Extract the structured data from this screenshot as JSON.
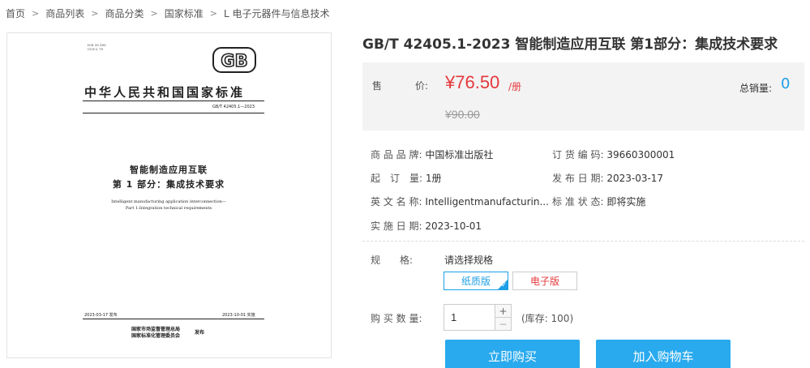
{
  "breadcrumb": {
    "items": [
      "首页",
      "商品列表",
      "商品分类",
      "国家标准",
      "L 电子元器件与信息技术"
    ]
  },
  "cover": {
    "ics_line1": "ICS 35.100",
    "ics_line2": "CCS L 75",
    "logo_text": "GB",
    "std_title": "中华人民共和国国家标准",
    "std_number": "GB/T 42405.1—2023",
    "cn_title_line1": "智能制造应用互联",
    "cn_title_line2": "第 1 部分：集成技术要求",
    "en_title_line1": "Intelligent manufacturing application interconnection—",
    "en_title_line2": "Part 1:Integration technical requirements",
    "issue_date": "2023-03-17 发布",
    "impl_date": "2023-10-01 实施",
    "issuer_line1": "国家市场监督管理总局",
    "issuer_line2": "国家标准化管理委员会",
    "publish_word": "发布"
  },
  "product": {
    "title": "GB/T 42405.1-2023 智能制造应用互联 第1部分：集成技术要求",
    "price_label": "售",
    "price_label2": "价:",
    "price": "¥76.50",
    "price_unit": "/册",
    "original_price": "¥90.00",
    "sales_label": "总销量:",
    "sales_count": "0"
  },
  "info": {
    "brand_label": "商 品 品 牌:",
    "brand_value": "中国标准出版社",
    "order_label": "订 货 编 码:",
    "order_value": "39660300001",
    "min_order_label": "起　订　量:",
    "min_order_value": "1册",
    "release_label": "发 布 日 期:",
    "release_value": "2023-03-17",
    "en_name_label": "英 文 名 称:",
    "en_name_value": "Intelligentmanufacturin...",
    "status_label": "标 准 状 态:",
    "status_value": "即将实施",
    "impl_label": "实 施 日 期:",
    "impl_value": "2023-10-01"
  },
  "spec": {
    "label": "规　　格:",
    "prompt": "请选择规格",
    "options": [
      "纸质版",
      "电子版"
    ],
    "selected": "纸质版"
  },
  "quantity": {
    "label": "购 买 数 量:",
    "value": "1",
    "plus": "+",
    "minus": "−",
    "stock": "(库存: 100)"
  },
  "buttons": {
    "buy": "立即购买",
    "cart": "加入购物车"
  },
  "colors": {
    "price": "#e4393c",
    "accent": "#1e9fe6",
    "button": "#29aaee"
  }
}
